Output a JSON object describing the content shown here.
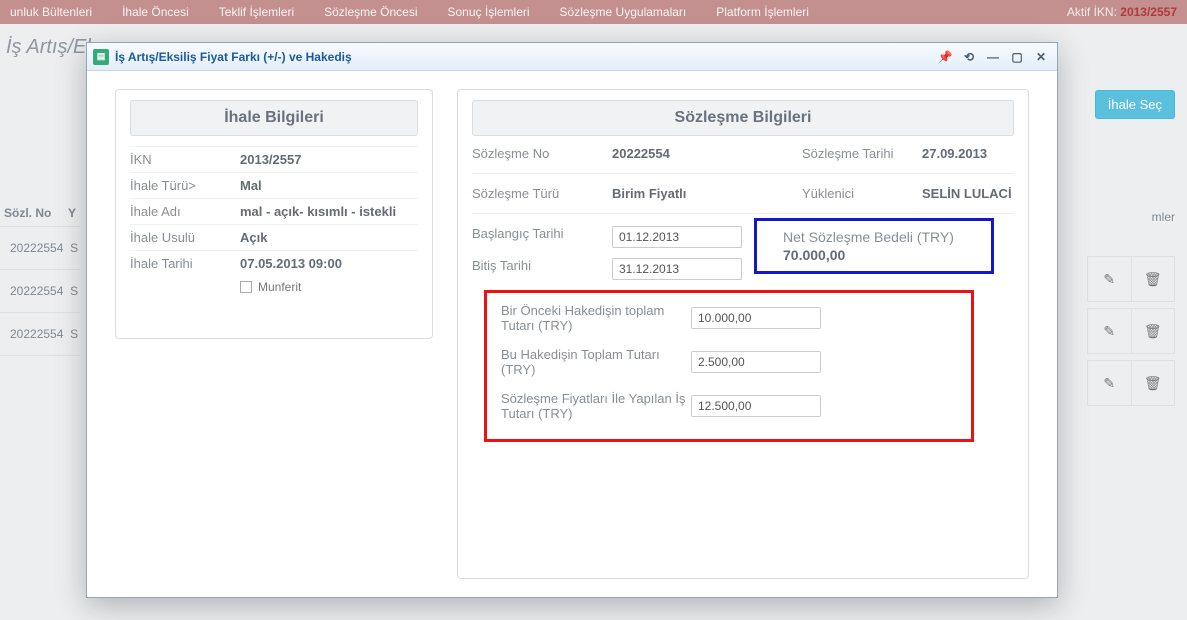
{
  "topnav": {
    "items": [
      "unluk Bültenleri",
      "İhale Öncesi",
      "Teklif İşlemleri",
      "Sözleşme Öncesi",
      "Sonuç İşlemleri",
      "Sözleşme Uygulamaları",
      "Platform İşlemleri"
    ],
    "aktif_ikn_label": "Aktif İKN:",
    "aktif_ikn_value": "2013/2557"
  },
  "page_heading": "İş Artış/Ek",
  "bg": {
    "col_sozl_no": "Sözl. No",
    "col_y": "Y",
    "rows": [
      "20222554",
      "20222554",
      "20222554"
    ],
    "row_suffix": "S",
    "mlr": "mler",
    "ihale_sec": "İhale Seç"
  },
  "modal": {
    "title": "İş Artış/Eksiliş Fiyat Farkı (+/-) ve Hakediş",
    "left": {
      "title": "İhale Bilgileri",
      "ikn_label": "İKN",
      "ikn_value": "2013/2557",
      "turu_label": "İhale Türü>",
      "turu_value": "Mal",
      "adi_label": "İhale Adı",
      "adi_value": "mal - açık- kısımlı - istekli",
      "usulu_label": "İhale Usulü",
      "usulu_value": "Açık",
      "tarihi_label": "İhale Tarihi",
      "tarihi_value": "07.05.2013 09:00",
      "munferit_label": "Munferit"
    },
    "right": {
      "title": "Sözleşme Bilgileri",
      "sozlesme_no_label": "Sözleşme No",
      "sozlesme_no_value": "20222554",
      "sozlesme_tarihi_label": "Sözleşme Tarihi",
      "sozlesme_tarihi_value": "27.09.2013",
      "sozlesme_turu_label": "Sözleşme Türü",
      "sozlesme_turu_value": "Birim Fiyatlı",
      "yuklenici_label": "Yüklenici",
      "yuklenici_value": "SELİN LULACİ",
      "baslangic_label": "Başlangıç Tarihi",
      "baslangic_value": "01.12.2013",
      "bitis_label": "Bitiş Tarihi",
      "bitis_value": "31.12.2013",
      "net_label": "Net Sözleşme Bedeli (TRY)",
      "net_value": "70.000,00",
      "onceki_label": "Bir Önceki Hakedişin toplam Tutarı (TRY)",
      "onceki_value": "10.000,00",
      "bu_label": "Bu Hakedişin Toplam Tutarı (TRY)",
      "bu_value": "2.500,00",
      "yapilan_label": "Sözleşme Fiyatları İle Yapılan İş Tutarı (TRY)",
      "yapilan_value": "12.500,00"
    }
  }
}
